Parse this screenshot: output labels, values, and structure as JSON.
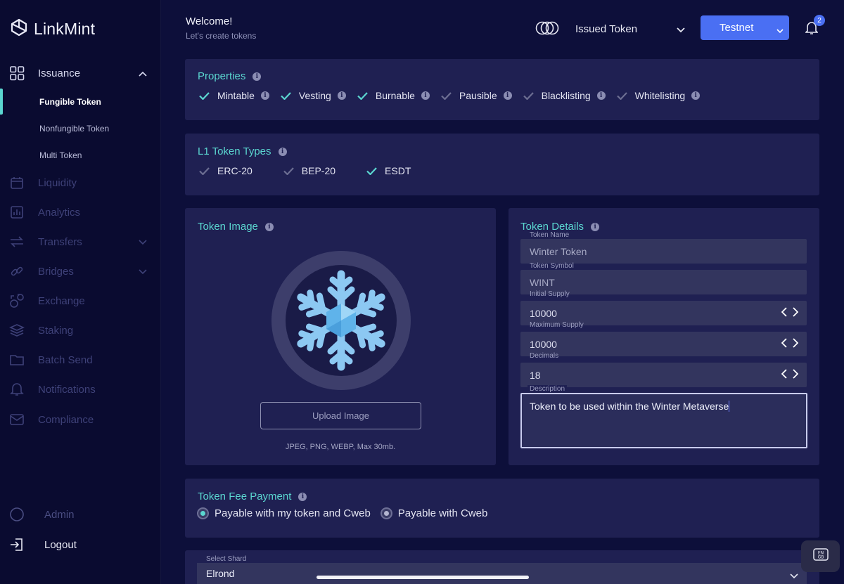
{
  "app": {
    "name": "LinkMint"
  },
  "sidebar": {
    "issuance": {
      "label": "Issuance",
      "children": [
        "Fungible Token",
        "Nonfungible Token",
        "Multi Token"
      ]
    },
    "items": [
      {
        "label": "Liquidity",
        "icon": "calendar-icon"
      },
      {
        "label": "Analytics",
        "icon": "chart-icon"
      },
      {
        "label": "Transfers",
        "icon": "transfer-icon"
      },
      {
        "label": "Bridges",
        "icon": "link-icon"
      },
      {
        "label": "Exchange",
        "icon": "exchange-icon"
      },
      {
        "label": "Staking",
        "icon": "layers-icon"
      },
      {
        "label": "Batch Send",
        "icon": "folder-icon"
      },
      {
        "label": "Notifications",
        "icon": "bell-icon"
      },
      {
        "label": "Compliance",
        "icon": "mail-icon"
      }
    ],
    "admin": "Admin",
    "logout": "Logout"
  },
  "header": {
    "welcome": "Welcome!",
    "subtitle": "Let's create tokens",
    "issued_token": "Issued Token",
    "network": "Testnet",
    "notification_count": "2"
  },
  "properties": {
    "title": "Properties",
    "items": [
      {
        "label": "Mintable",
        "checked": true
      },
      {
        "label": "Vesting",
        "checked": true
      },
      {
        "label": "Burnable",
        "checked": true
      },
      {
        "label": "Pausible",
        "checked": false
      },
      {
        "label": "Blacklisting",
        "checked": false
      },
      {
        "label": "Whitelisting",
        "checked": false
      }
    ]
  },
  "l1_types": {
    "title": "L1 Token Types",
    "items": [
      {
        "label": "ERC-20",
        "checked": false
      },
      {
        "label": "BEP-20",
        "checked": false
      },
      {
        "label": "ESDT",
        "checked": true
      }
    ]
  },
  "token_image": {
    "title": "Token Image",
    "upload_label": "Upload Image",
    "formats": "JPEG, PNG, WEBP, Max 30mb."
  },
  "token_details": {
    "title": "Token Details",
    "token_name": {
      "label": "Token Name",
      "value": "Winter Token"
    },
    "token_symbol": {
      "label": "Token Symbol",
      "value": "WINT"
    },
    "initial_supply": {
      "label": "Initial Supply",
      "value": "10000"
    },
    "maximum_supply": {
      "label": "Maximum Supply",
      "value": "10000"
    },
    "decimals": {
      "label": "Decimals",
      "value": "18"
    },
    "description": {
      "label": "Description",
      "value": "Token to be used within the Winter Metaverse"
    }
  },
  "fee": {
    "title": "Token Fee Payment",
    "options": [
      {
        "label": "Payable with my token and Cweb",
        "selected": true
      },
      {
        "label": "Payable with Cweb",
        "selected": false
      }
    ]
  },
  "shard": {
    "label": "Select Shard",
    "value": "Elrond"
  },
  "keyboard": {
    "label_top": "EN",
    "label_bottom": "GB"
  },
  "colors": {
    "accent": "#5bd6d0",
    "primary": "#4a6ff3",
    "background": "#0d0f3a",
    "panel": "#1f2052"
  }
}
